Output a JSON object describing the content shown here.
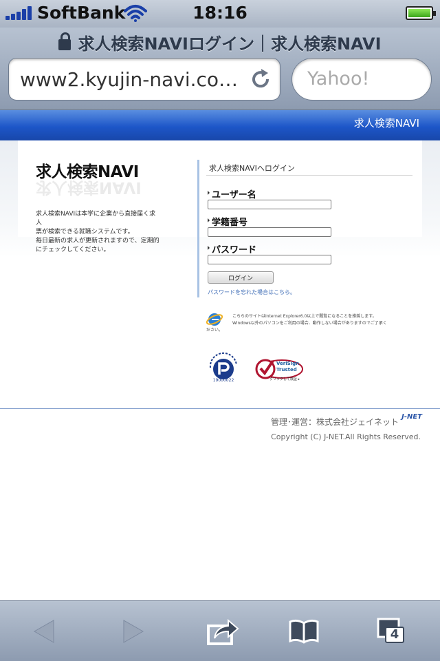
{
  "status_bar": {
    "carrier": "SoftBank",
    "time": "18:16",
    "battery": 1.0
  },
  "browser": {
    "page_title": "求人検索NAVIログイン｜求人検索NAVI",
    "url": "www2.kyujin-navi.co…",
    "search_placeholder": "Yahoo!",
    "tab_count": "4"
  },
  "site": {
    "header_name": "求人検索NAVI",
    "logo": "求人検索NAVI",
    "description": [
      "求人検索NAVIは本学に企業から直接届く求人",
      "票が検索できる就職システムです。",
      "毎日最新の求人が更新されますので、定期的",
      "にチェックしてください。"
    ],
    "login": {
      "title": "求人検索NAVIへログイン",
      "fields": [
        {
          "label": "ユーザー名",
          "value": ""
        },
        {
          "label": "学籍番号",
          "value": ""
        },
        {
          "label": "パスワード",
          "value": ""
        }
      ],
      "button_label": "ログイン",
      "forgot_link": "パスワードを忘れた場合はこちら。"
    },
    "browser_note": [
      "こちらのサイトはInternet Explorer6.0以上で閲覧になることを推奨します。",
      "Windows以外のパソコンをご利用の場合、動作しない場合がありますのでご了承く",
      "ださい。"
    ],
    "privacy_mark_id": "19000022",
    "verisign": {
      "line1": "VeriSign",
      "line2": "Trusted",
      "caption": "クリックして検証 ▸"
    },
    "footer": {
      "management": "管理･運営：株式会社ジェイネット",
      "brand": "J-NET",
      "copyright": "Copyright (C) J-NET.All Rights Reserved."
    }
  },
  "colors": {
    "header_blue": "#1d56c8",
    "link_blue": "#3c6bb5",
    "panel_accent": "#a8c2e4"
  },
  "icons": {
    "signal": "signal-bars-icon",
    "wifi": "wifi-icon",
    "battery": "battery-icon",
    "lock": "lock-icon",
    "reload": "reload-icon",
    "back": "back-arrow-icon",
    "forward": "forward-arrow-icon",
    "share": "share-icon",
    "bookmarks": "bookmarks-icon",
    "tabs": "tabs-icon"
  }
}
